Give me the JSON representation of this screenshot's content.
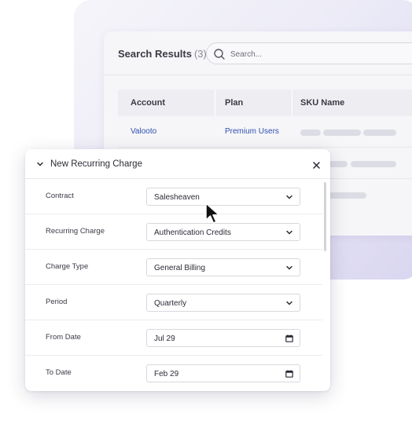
{
  "search_results": {
    "title": "Search Results",
    "count": "(3)",
    "search_placeholder": "Search...",
    "columns": [
      "Account",
      "Plan",
      "SKU Name"
    ],
    "rows": [
      {
        "account": "Valooto",
        "plan": "Premium Users"
      }
    ]
  },
  "recurring_charge_panel": {
    "title": "New Recurring Charge",
    "fields": [
      {
        "label": "Contract",
        "value": "Salesheaven",
        "icon": "chevron-down-icon"
      },
      {
        "label": "Recurring Charge",
        "value": "Authentication Credits",
        "icon": "chevron-down-icon"
      },
      {
        "label": "Charge Type",
        "value": "General Billing",
        "icon": "chevron-down-icon"
      },
      {
        "label": "Period",
        "value": "Quarterly",
        "icon": "chevron-down-icon"
      },
      {
        "label": "From Date",
        "value": "Jul 29",
        "icon": "calendar-icon"
      },
      {
        "label": "To Date",
        "value": "Feb 29",
        "icon": "calendar-icon"
      }
    ]
  },
  "colors": {
    "link": "#2f4fb0",
    "backdrop_gradient_end": "#d9d6f0",
    "text": "#2b2b36"
  }
}
